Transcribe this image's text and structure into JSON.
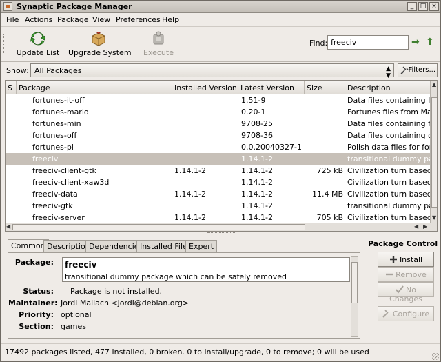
{
  "window": {
    "title": "Synaptic Package Manager"
  },
  "menu": [
    "File",
    "Actions",
    "Package",
    "View",
    "Preferences",
    "Help"
  ],
  "toolbar": {
    "update_list": "Update List",
    "upgrade_system": "Upgrade System",
    "execute": "Execute",
    "find_label": "Find:",
    "find_value": "freeciv"
  },
  "show": {
    "label": "Show:",
    "selected": "All Packages",
    "filters_label": "Filters..."
  },
  "table": {
    "headers": [
      "S",
      "Package",
      "Installed Version",
      "Latest Version",
      "Size",
      "Description"
    ],
    "rows": [
      {
        "name": "fortunes-it-off",
        "installed": "",
        "latest": "1.51-9",
        "size": "",
        "desc": "Data files containing Itali"
      },
      {
        "name": "fortunes-mario",
        "installed": "",
        "latest": "0.20-1",
        "size": "",
        "desc": "Fortunes files from Mario"
      },
      {
        "name": "fortunes-min",
        "installed": "",
        "latest": "9708-25",
        "size": "",
        "desc": "Data files containing fort"
      },
      {
        "name": "fortunes-off",
        "installed": "",
        "latest": "9708-36",
        "size": "",
        "desc": "Data files containing offe"
      },
      {
        "name": "fortunes-pl",
        "installed": "",
        "latest": "0.0.20040327-1",
        "size": "",
        "desc": "Polish data files for fortur"
      },
      {
        "name": "freeciv",
        "installed": "",
        "latest": "1.14.1-2",
        "size": "",
        "desc": "transitional dummy pack"
      },
      {
        "name": "freeciv-client-gtk",
        "installed": "1.14.1-2",
        "latest": "1.14.1-2",
        "size": "725 kB",
        "desc": "Civilization turn based st"
      },
      {
        "name": "freeciv-client-xaw3d",
        "installed": "",
        "latest": "1.14.1-2",
        "size": "",
        "desc": "Civilization turn based st"
      },
      {
        "name": "freeciv-data",
        "installed": "1.14.1-2",
        "latest": "1.14.1-2",
        "size": "11.4 MB",
        "desc": "Civilization turn based st"
      },
      {
        "name": "freeciv-gtk",
        "installed": "",
        "latest": "1.14.1-2",
        "size": "",
        "desc": "transitional dummy pack"
      },
      {
        "name": "freeciv-server",
        "installed": "1.14.1-2",
        "latest": "1.14.1-2",
        "size": "705 kB",
        "desc": "Civilization turn based st"
      }
    ],
    "selected_index": 5
  },
  "tabs": [
    "Common",
    "Description",
    "Dependencies",
    "Installed Files",
    "Expert"
  ],
  "details": {
    "package_label": "Package:",
    "package_name": "freeciv",
    "package_short": "transitional dummy package which can be safely removed",
    "status_label": "Status:",
    "status_value": "Package is not installed.",
    "maintainer_label": "Maintainer:",
    "maintainer_value": "Jordi Mallach <jordi@debian.org>",
    "priority_label": "Priority:",
    "priority_value": "optional",
    "section_label": "Section:",
    "section_value": "games"
  },
  "package_control": {
    "title": "Package Control",
    "install": "Install",
    "remove": "Remove",
    "no_changes": "No Changes",
    "configure": "Configure"
  },
  "status": "17492 packages listed, 477 installed, 0 broken. 0 to install/upgrade, 0 to remove; 0  will be used",
  "colors": {
    "selection": "#c7c0b8",
    "window_bg": "#efebe7"
  }
}
